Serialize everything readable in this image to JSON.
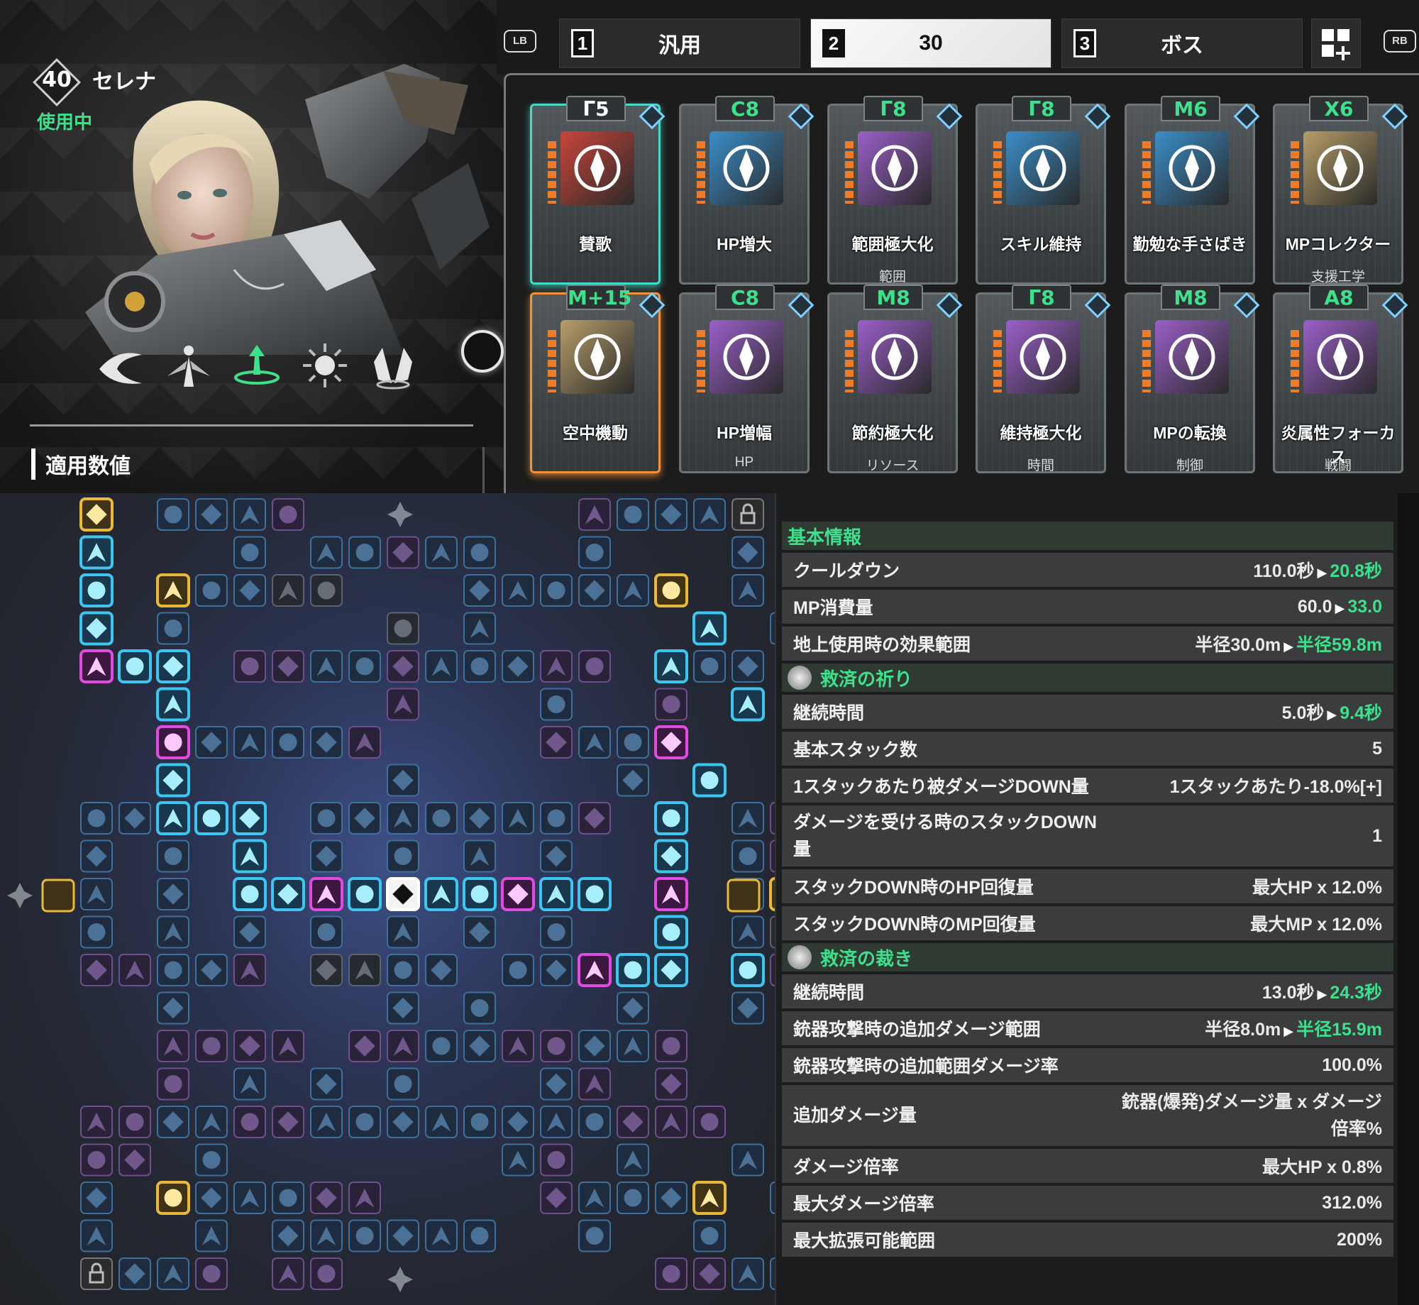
{
  "character": {
    "level": "40",
    "name": "セレナ",
    "status": "使用中"
  },
  "skill_icons": [
    "wing-swipe-icon",
    "angel-icon",
    "hymn-skill-icon",
    "sun-skill-icon",
    "wings-icon"
  ],
  "section_title": "適用数値",
  "shoulders": {
    "left": "LB",
    "right": "RB"
  },
  "tabs": [
    {
      "num": "1",
      "label": "汎用",
      "active": false
    },
    {
      "num": "2",
      "label": "30",
      "active": true
    },
    {
      "num": "3",
      "label": "ボス",
      "active": false
    }
  ],
  "cards": [
    {
      "sym": "Γ",
      "cost": "5",
      "name": "賛歌",
      "category": "",
      "art": "#c9453a",
      "highlight": "teal",
      "green": false
    },
    {
      "sym": "C",
      "cost": "8",
      "name": "HP増大",
      "category": "",
      "art": "#3a8ec9",
      "highlight": "",
      "green": true
    },
    {
      "sym": "Γ",
      "cost": "8",
      "name": "範囲極大化",
      "category": "範囲",
      "art": "#9b5fc9",
      "highlight": "",
      "green": true
    },
    {
      "sym": "Γ",
      "cost": "8",
      "name": "スキル維持",
      "category": "",
      "art": "#3a8ec9",
      "highlight": "",
      "green": true
    },
    {
      "sym": "M",
      "cost": "6",
      "name": "勤勉な手さばき",
      "category": "",
      "art": "#3a8ec9",
      "highlight": "",
      "green": true
    },
    {
      "sym": "X",
      "cost": "6",
      "name": "MPコレクター",
      "category": "支援工学",
      "art": "#b79e6a",
      "highlight": "",
      "green": true
    },
    {
      "sym": "M",
      "cost": "+15",
      "name": "空中機動",
      "category": "",
      "art": "#b79e6a",
      "highlight": "orange",
      "green": true
    },
    {
      "sym": "C",
      "cost": "8",
      "name": "HP増幅",
      "category": "HP",
      "art": "#9b5fc9",
      "highlight": "",
      "green": true
    },
    {
      "sym": "M",
      "cost": "8",
      "name": "節約極大化",
      "category": "リソース",
      "art": "#9b5fc9",
      "highlight": "",
      "green": true
    },
    {
      "sym": "Γ",
      "cost": "8",
      "name": "維持極大化",
      "category": "時間",
      "art": "#9b5fc9",
      "highlight": "",
      "green": true
    },
    {
      "sym": "M",
      "cost": "8",
      "name": "MPの転換",
      "category": "制御",
      "art": "#9b5fc9",
      "highlight": "",
      "green": true
    },
    {
      "sym": "A",
      "cost": "8",
      "name": "炎属性フォーカス",
      "category": "戦闘",
      "art": "#9b5fc9",
      "highlight": "",
      "green": true
    }
  ],
  "board": {
    "colors": {
      "active_cyan": "#3ec6f0",
      "active_magenta": "#e04be0",
      "gold": "#e8b93a",
      "inactive_blue": "#3f6f9c",
      "inactive_purple": "#6e4f8c",
      "inactive_gray": "#5a6470"
    }
  },
  "stats": {
    "sections": [
      {
        "title": "基本情報",
        "icon": false,
        "rows": [
          {
            "label": "クールダウン",
            "old": "110.0秒",
            "new": "20.8秒"
          },
          {
            "label": "MP消費量",
            "old": "60.0",
            "new": "33.0"
          },
          {
            "label": "地上使用時の効果範囲",
            "old": "半径30.0m",
            "new": "半径59.8m"
          }
        ]
      },
      {
        "title": "救済の祈り",
        "icon": true,
        "rows": [
          {
            "label": "継続時間",
            "old": "5.0秒",
            "new": "9.4秒"
          },
          {
            "label": "基本スタック数",
            "old": "5",
            "new": ""
          },
          {
            "label": "1スタックあたり被ダメージDOWN量",
            "old": "1スタックあたり-18.0%[+]",
            "new": ""
          },
          {
            "label": "ダメージを受ける時のスタックDOWN量",
            "old": "1",
            "new": "",
            "tall": true
          },
          {
            "label": "スタックDOWN時のHP回復量",
            "old": "最大HP x 12.0%",
            "new": ""
          },
          {
            "label": "スタックDOWN時のMP回復量",
            "old": "最大MP x 12.0%",
            "new": ""
          }
        ]
      },
      {
        "title": "救済の裁き",
        "icon": true,
        "rows": [
          {
            "label": "継続時間",
            "old": "13.0秒",
            "new": "24.3秒"
          },
          {
            "label": "銃器攻撃時の追加ダメージ範囲",
            "old": "半径8.0m",
            "new": "半径15.9m"
          },
          {
            "label": "銃器攻撃時の追加範囲ダメージ率",
            "old": "100.0%",
            "new": ""
          },
          {
            "label": "追加ダメージ量",
            "old": "銃器(爆発)ダメージ量 x ダメージ倍率%",
            "new": "",
            "tall": true
          },
          {
            "label": "ダメージ倍率",
            "old": "最大HP x 0.8%",
            "new": ""
          },
          {
            "label": "最大ダメージ倍率",
            "old": "312.0%",
            "new": ""
          },
          {
            "label": "最大拡張可能範囲",
            "old": "200%",
            "new": ""
          }
        ]
      }
    ]
  }
}
